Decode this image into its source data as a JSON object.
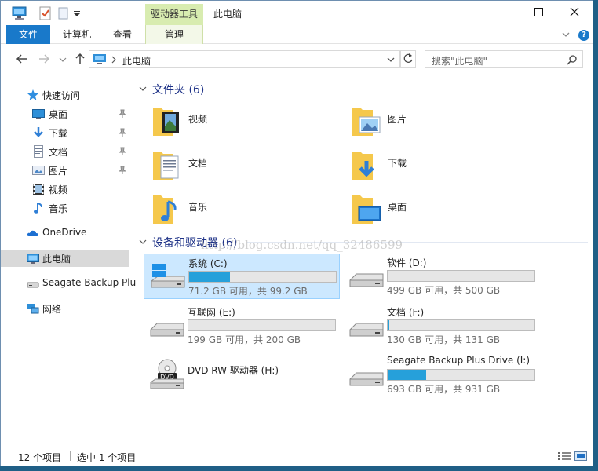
{
  "titlebar": {
    "title": "此电脑",
    "context_tab": "驱动器工具"
  },
  "ribbon": {
    "tabs": [
      {
        "label": "文件"
      },
      {
        "label": "计算机"
      },
      {
        "label": "查看"
      },
      {
        "label": "管理"
      }
    ],
    "help": "?"
  },
  "address": {
    "path": "此电脑",
    "search_placeholder": "搜索\"此电脑\""
  },
  "nav": {
    "quick_access": "快速访问",
    "pinned": [
      {
        "label": "桌面",
        "icon": "desktop-icon",
        "pinned": true
      },
      {
        "label": "下载",
        "icon": "download-icon",
        "pinned": true
      },
      {
        "label": "文档",
        "icon": "document-icon",
        "pinned": true
      },
      {
        "label": "图片",
        "icon": "picture-icon",
        "pinned": true
      },
      {
        "label": "视频",
        "icon": "video-icon",
        "pinned": false
      },
      {
        "label": "音乐",
        "icon": "music-icon",
        "pinned": false
      }
    ],
    "onedrive": "OneDrive",
    "this_pc": "此电脑",
    "seagate": "Seagate Backup Plu",
    "network": "网络"
  },
  "folders_group": {
    "title": "文件夹 (6)",
    "items": [
      {
        "label": "视频",
        "icon": "video-folder-icon"
      },
      {
        "label": "图片",
        "icon": "picture-folder-icon"
      },
      {
        "label": "文档",
        "icon": "document-folder-icon"
      },
      {
        "label": "下载",
        "icon": "download-folder-icon"
      },
      {
        "label": "音乐",
        "icon": "music-folder-icon"
      },
      {
        "label": "桌面",
        "icon": "desktop-folder-icon"
      }
    ]
  },
  "drives_group": {
    "title": "设备和驱动器 (6)",
    "items": [
      {
        "name": "系统 (C:)",
        "info": "71.2 GB 可用，共 99.2 GB",
        "used_fraction": 0.28,
        "icon": "windows-drive-icon",
        "selected": true
      },
      {
        "name": "软件 (D:)",
        "info": "499 GB 可用，共 500 GB",
        "used_fraction": 0.0,
        "icon": "hard-drive-icon",
        "selected": false
      },
      {
        "name": "互联网 (E:)",
        "info": "199 GB 可用，共 200 GB",
        "used_fraction": 0.0,
        "icon": "hard-drive-icon",
        "selected": false
      },
      {
        "name": "文档 (F:)",
        "info": "130 GB 可用，共 131 GB",
        "used_fraction": 0.01,
        "icon": "hard-drive-icon",
        "selected": false
      },
      {
        "name": "DVD RW 驱动器 (H:)",
        "info": "",
        "used_fraction": null,
        "icon": "dvd-drive-icon",
        "selected": false
      },
      {
        "name": "Seagate Backup Plus Drive (I:)",
        "info": "693 GB 可用，共 931 GB",
        "used_fraction": 0.26,
        "icon": "hard-drive-icon",
        "selected": false
      }
    ]
  },
  "watermark": "http://blog.csdn.net/qq_32486599",
  "status": {
    "count": "12 个项目",
    "selection": "选中 1 个项目"
  },
  "colors": {
    "accent": "#1979ca",
    "bar_fill": "#26a0da",
    "selection": "#cce8ff",
    "context_tab": "#d8ecb0"
  }
}
